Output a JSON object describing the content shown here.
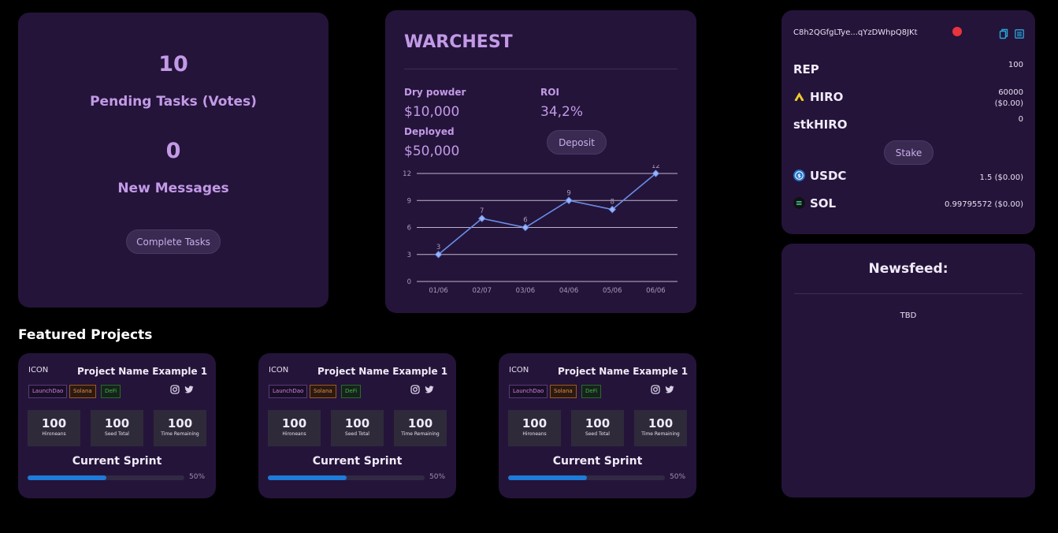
{
  "tasks": {
    "pending_count": "10",
    "pending_label": "Pending Tasks (Votes)",
    "messages_count": "0",
    "messages_label": "New Messages",
    "button_label": "Complete Tasks"
  },
  "warchest": {
    "title": "WARCHEST",
    "dry_powder_label": "Dry powder",
    "dry_powder_value": "$10,000",
    "roi_label": "ROI",
    "roi_value": "34,2%",
    "deployed_label": "Deployed",
    "deployed_value": "$50,000",
    "deposit_label": "Deposit"
  },
  "chart_data": {
    "type": "line",
    "categories": [
      "01/06",
      "02/07",
      "03/06",
      "04/06",
      "05/06",
      "06/06"
    ],
    "values": [
      3,
      7,
      6,
      9,
      8,
      12
    ],
    "yticks": [
      0,
      3,
      6,
      9,
      12
    ],
    "ylim": [
      0,
      12
    ],
    "grid": true,
    "data_labels": true,
    "colors": {
      "line": "#6a8ee8",
      "grid": "#bdb6c8",
      "label": "#a89cb8"
    }
  },
  "wallet": {
    "address": "C8h2QGfgLTye...qYzDWhpQ8JKt",
    "icons": {
      "status": "status-dot-icon",
      "copy": "copy-icon",
      "explorer": "explorer-icon"
    },
    "rep_label": "REP",
    "rep_value": "100",
    "hiro_label": "HIRO",
    "hiro_value": "60000",
    "hiro_usd": "($0.00)",
    "stkhiro_label": "stkHIRO",
    "stkhiro_value": "0",
    "stake_label": "Stake",
    "usdc_label": "USDC",
    "usdc_value": "1.5 ($0.00)",
    "sol_label": "SOL",
    "sol_value": "0.99795572 ($0.00)",
    "colors": {
      "usdc": "#2775ca",
      "hiro": "#f2c832",
      "status": "#e8343c",
      "accent": "#2aa6d8"
    }
  },
  "newsfeed": {
    "title": "Newsfeed:",
    "body": "TBD"
  },
  "featured": {
    "title": "Featured Projects",
    "projects": [
      {
        "icon": "ICON",
        "name": "Project Name Example 1",
        "tags": [
          "LaunchDao",
          "Solana",
          "DeFi"
        ],
        "stats": [
          {
            "value": "100",
            "label": "Hironeans"
          },
          {
            "value": "100",
            "label": "Seed Total"
          },
          {
            "value": "100",
            "label": "Time Remaining"
          }
        ],
        "sprint_label": "Current Sprint",
        "progress": 50,
        "progress_label": "50%"
      },
      {
        "icon": "ICON",
        "name": "Project Name Example 1",
        "tags": [
          "LaunchDao",
          "Solana",
          "DeFi"
        ],
        "stats": [
          {
            "value": "100",
            "label": "Hironeans"
          },
          {
            "value": "100",
            "label": "Seed Total"
          },
          {
            "value": "100",
            "label": "Time Remaining"
          }
        ],
        "sprint_label": "Current Sprint",
        "progress": 50,
        "progress_label": "50%"
      },
      {
        "icon": "ICON",
        "name": "Project Name Example 1",
        "tags": [
          "LaunchDao",
          "Solana",
          "DeFi"
        ],
        "stats": [
          {
            "value": "100",
            "label": "Hironeans"
          },
          {
            "value": "100",
            "label": "Seed Total"
          },
          {
            "value": "100",
            "label": "Time Remaining"
          }
        ],
        "sprint_label": "Current Sprint",
        "progress": 50,
        "progress_label": "50%"
      }
    ]
  }
}
